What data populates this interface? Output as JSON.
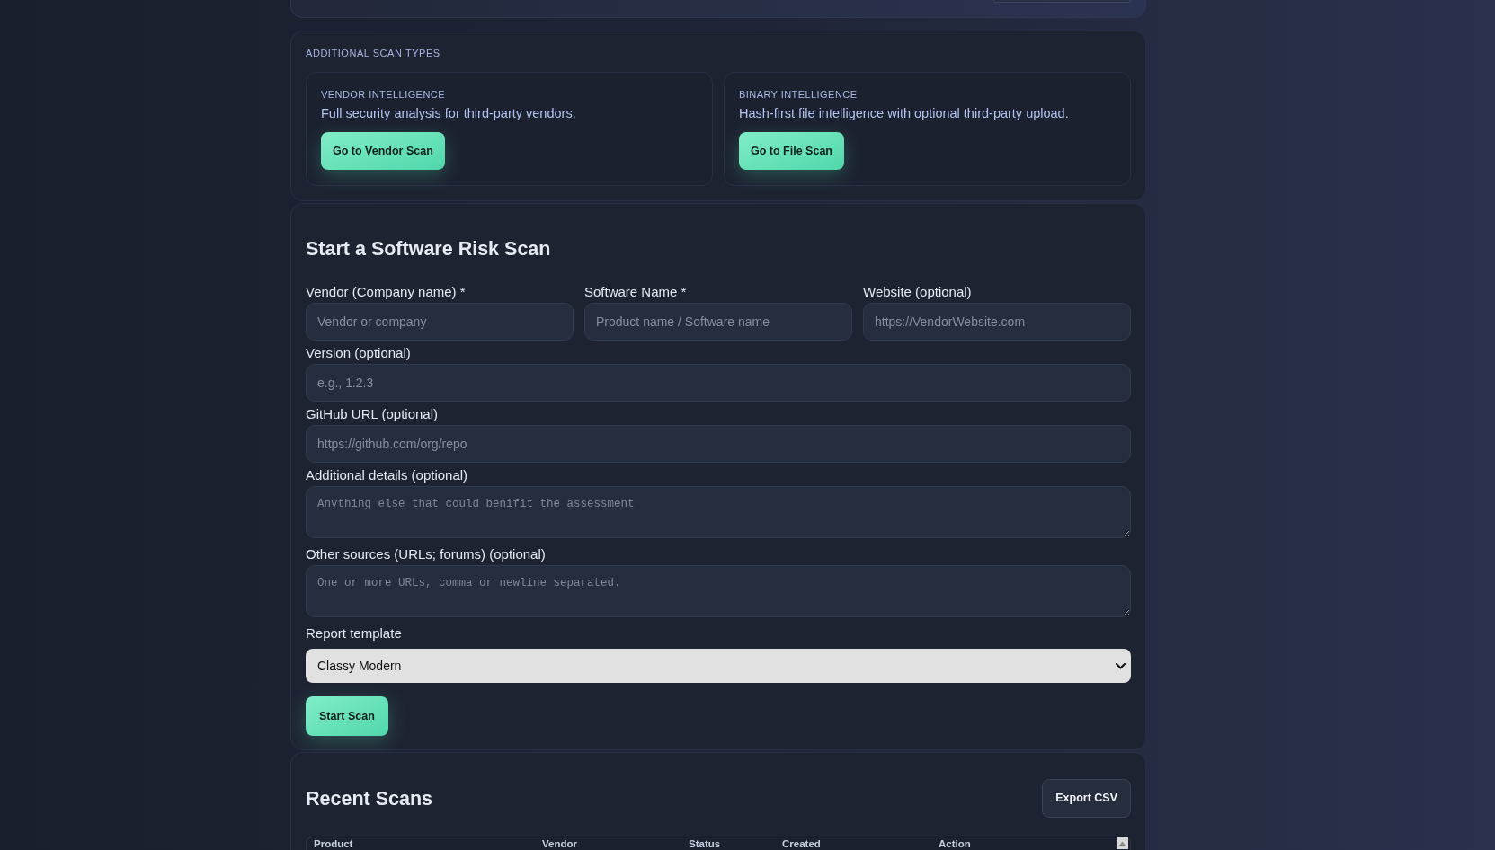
{
  "additional_scan_types": {
    "heading": "ADDITIONAL SCAN TYPES",
    "cards": [
      {
        "label": "VENDOR INTELLIGENCE",
        "description": "Full security analysis for third-party vendors.",
        "button": "Go to Vendor Scan"
      },
      {
        "label": "BINARY INTELLIGENCE",
        "description": "Hash-first file intelligence with optional third-party upload.",
        "button": "Go to File Scan"
      }
    ]
  },
  "scan_form": {
    "title": "Start a Software Risk Scan",
    "rows": [
      {
        "fields": [
          {
            "kind": "input",
            "label": "Vendor (Company name) *",
            "placeholder": "Vendor or company"
          },
          {
            "kind": "input",
            "label": "Software Name *",
            "placeholder": "Product name / Software name"
          },
          {
            "kind": "input",
            "label": "Website (optional)",
            "placeholder": "https://VendorWebsite.com"
          }
        ]
      },
      {
        "fields": [
          {
            "kind": "input",
            "label": "Version (optional)",
            "placeholder": "e.g., 1.2.3"
          }
        ]
      },
      {
        "fields": [
          {
            "kind": "input",
            "label": "GitHub URL (optional)",
            "placeholder": "https://github.com/org/repo"
          }
        ]
      },
      {
        "fields": [
          {
            "kind": "textarea",
            "label": "Additional details (optional)",
            "placeholder": "Anything else that could benifit the assessment"
          }
        ]
      },
      {
        "fields": [
          {
            "kind": "textarea",
            "label": "Other sources (URLs; forums) (optional)",
            "placeholder": "One or more URLs, comma or newline separated."
          }
        ]
      },
      {
        "fields": [
          {
            "kind": "select",
            "label": "Report template",
            "value": "Classy Modern"
          }
        ]
      }
    ],
    "submit_button": "Start Scan"
  },
  "recent_scans": {
    "title": "Recent Scans",
    "export_button": "Export CSV",
    "table": {
      "columns": [
        "Product",
        "Vendor",
        "Status",
        "Created",
        "Action"
      ]
    }
  }
}
